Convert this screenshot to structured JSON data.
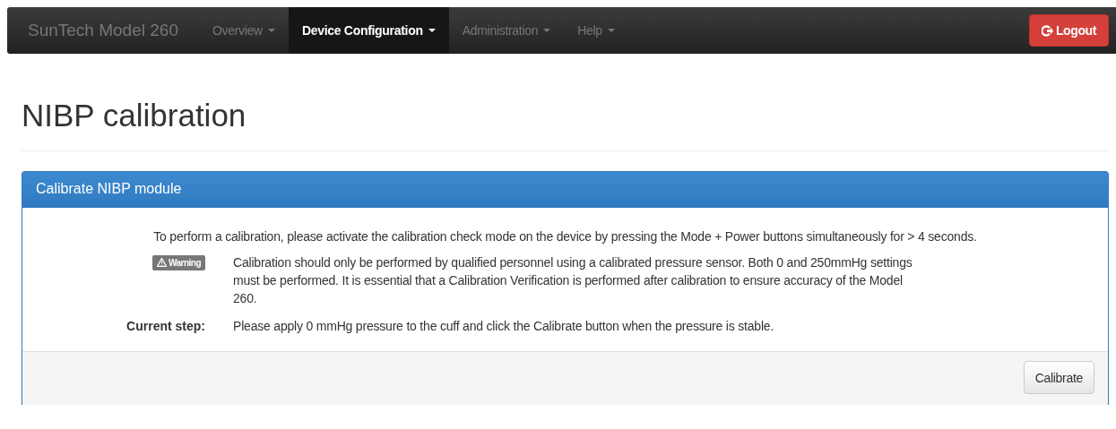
{
  "navbar": {
    "brand": "SunTech Model 260",
    "items": [
      {
        "label": "Overview",
        "selected": false
      },
      {
        "label": "Device Configuration",
        "selected": true
      },
      {
        "label": "Administration",
        "selected": false
      },
      {
        "label": "Help",
        "selected": false
      }
    ],
    "logout_button": "Logout"
  },
  "page_title": "NIBP calibration",
  "panel": {
    "title": "Calibrate NIBP module",
    "intro": "To perform a calibration, please activate the calibration check mode on the device by pressing the Mode + Power buttons simultaneously for > 4 seconds.",
    "rows": [
      {
        "kind": "badge",
        "label": "Warning",
        "text": "Calibration should only be performed by qualified personnel using a calibrated pressure sensor. Both 0 and 250mmHg settings must be performed. It is essential that a Calibration Verification is performed after calibration to ensure accuracy of the Model 260."
      },
      {
        "kind": "heading",
        "label": "Current step:",
        "text": "Please apply 0 mmHg pressure to the cuff and click the Calibrate button when the pressure is stable."
      }
    ],
    "footer_button": "Calibrate"
  }
}
